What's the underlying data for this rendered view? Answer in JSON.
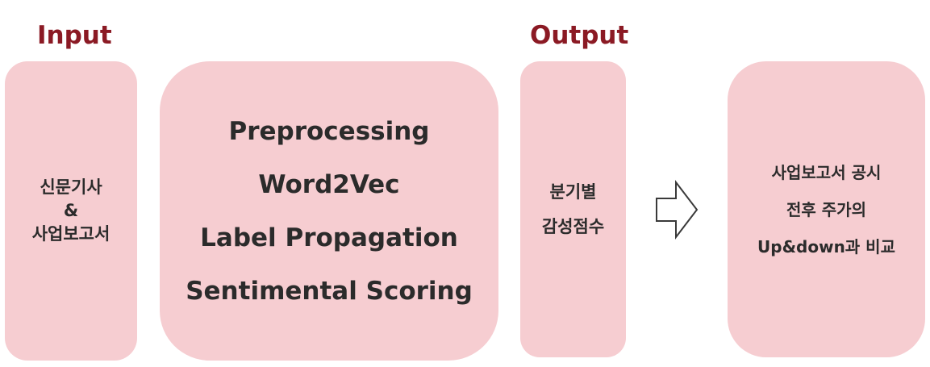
{
  "headings": {
    "input": "Input",
    "output": "Output"
  },
  "input_box": {
    "lines": [
      "신문기사",
      "&",
      "사업보고서"
    ]
  },
  "process_box": {
    "lines": [
      "Preprocessing",
      "Word2Vec",
      "Label Propagation",
      "Sentimental Scoring"
    ]
  },
  "output_box": {
    "lines": [
      "분기별",
      "감성점수"
    ]
  },
  "result_box": {
    "lines": [
      "사업보고서 공시",
      "전후 주가의",
      "Up&down과 비교"
    ]
  },
  "colors": {
    "heading": "#8b1a24",
    "box_fill": "#f6cdd1",
    "text": "#2b2b2b",
    "arrow_stroke": "#3a3a3a"
  },
  "icons": {
    "flow_arrow": "right-arrow-outline-icon"
  }
}
